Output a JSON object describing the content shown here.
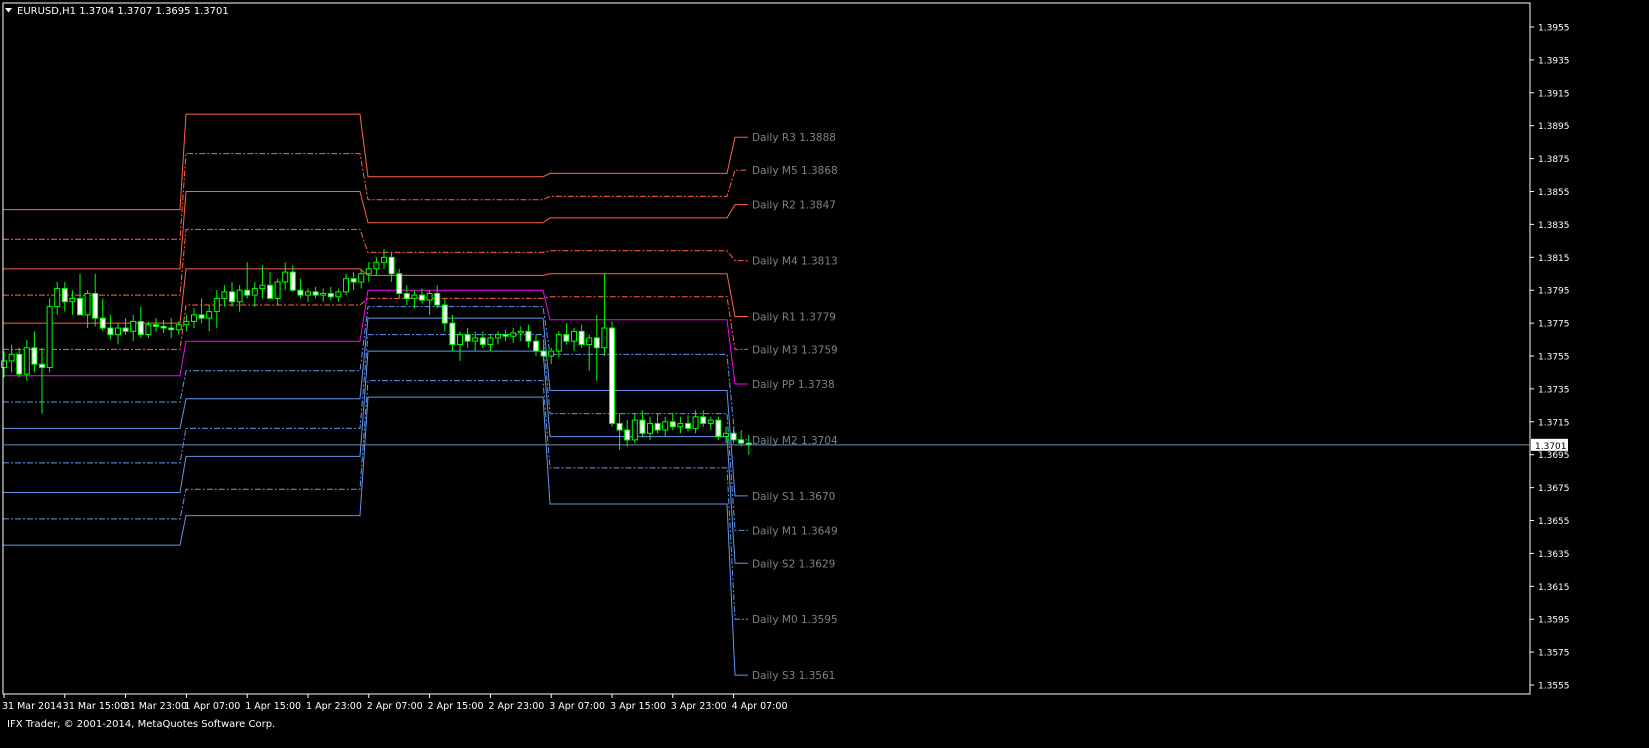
{
  "window": {
    "header_text": "EURUSD,H1  1.3704 1.3707 1.3695 1.3701",
    "menu_icon": "triangle-down-icon"
  },
  "footer": {
    "copyright": "IFX Trader, © 2001-2014, MetaQuotes Software Corp."
  },
  "colors": {
    "background": "#000000",
    "axis": "#ffffff",
    "bull": "#00ff00",
    "bear": "#ffffff",
    "resistance": "#ff6347",
    "pivot": "#ff00ff",
    "support": "#6495ed",
    "current_price_line": "#6e8fb0",
    "level_label": "#808080"
  },
  "chart_data": {
    "type": "candlestick",
    "symbol": "EURUSD",
    "timeframe": "H1",
    "ylim": [
      1.3545,
      1.3965
    ],
    "current_price": 1.3701,
    "current_price_label": "1.3701",
    "y_ticks": [
      "1.3955",
      "1.3935",
      "1.3915",
      "1.3895",
      "1.3875",
      "1.3855",
      "1.3835",
      "1.3815",
      "1.3795",
      "1.3775",
      "1.3755",
      "1.3735",
      "1.3715",
      "1.3695",
      "1.3675",
      "1.3655",
      "1.3635",
      "1.3615",
      "1.3595",
      "1.3575",
      "1.3555"
    ],
    "x_ticks": [
      "31 Mar 2014",
      "31 Mar 15:00",
      "31 Mar 23:00",
      "1 Apr 07:00",
      "1 Apr 15:00",
      "1 Apr 23:00",
      "2 Apr 07:00",
      "2 Apr 15:00",
      "2 Apr 23:00",
      "3 Apr 07:00",
      "3 Apr 15:00",
      "3 Apr 23:00",
      "4 Apr 07:00"
    ],
    "x_tick_index": [
      0,
      8,
      16,
      24,
      32,
      40,
      48,
      56,
      64,
      72,
      80,
      88,
      96
    ],
    "bar_count": 99,
    "ohlc": [
      [
        1.3748,
        1.3758,
        1.3742,
        1.3752
      ],
      [
        1.3752,
        1.3762,
        1.3745,
        1.3756
      ],
      [
        1.3756,
        1.376,
        1.3742,
        1.3744
      ],
      [
        1.3744,
        1.3765,
        1.374,
        1.376
      ],
      [
        1.376,
        1.377,
        1.3745,
        1.375
      ],
      [
        1.375,
        1.376,
        1.372,
        1.3748
      ],
      [
        1.3748,
        1.379,
        1.3745,
        1.3785
      ],
      [
        1.3785,
        1.38,
        1.378,
        1.3796
      ],
      [
        1.3796,
        1.38,
        1.3782,
        1.3788
      ],
      [
        1.3788,
        1.3795,
        1.378,
        1.379
      ],
      [
        1.379,
        1.3805,
        1.3782,
        1.378
      ],
      [
        1.378,
        1.3795,
        1.3772,
        1.3793
      ],
      [
        1.3793,
        1.3805,
        1.3773,
        1.3778
      ],
      [
        1.3778,
        1.379,
        1.377,
        1.3772
      ],
      [
        1.3772,
        1.378,
        1.3765,
        1.3768
      ],
      [
        1.3768,
        1.3775,
        1.3762,
        1.3772
      ],
      [
        1.3772,
        1.3778,
        1.3768,
        1.377
      ],
      [
        1.377,
        1.378,
        1.3764,
        1.3776
      ],
      [
        1.3776,
        1.3785,
        1.3766,
        1.3768
      ],
      [
        1.3768,
        1.3776,
        1.3766,
        1.3774
      ],
      [
        1.3774,
        1.3778,
        1.377,
        1.3773
      ],
      [
        1.3773,
        1.3777,
        1.3769,
        1.3772
      ],
      [
        1.3772,
        1.3778,
        1.3766,
        1.3771
      ],
      [
        1.3771,
        1.3776,
        1.3768,
        1.3774
      ],
      [
        1.3774,
        1.378,
        1.377,
        1.3776
      ],
      [
        1.3776,
        1.3784,
        1.3772,
        1.378
      ],
      [
        1.378,
        1.379,
        1.3775,
        1.3778
      ],
      [
        1.3778,
        1.3786,
        1.377,
        1.3782
      ],
      [
        1.3782,
        1.3795,
        1.3772,
        1.379
      ],
      [
        1.379,
        1.3798,
        1.3785,
        1.3794
      ],
      [
        1.3794,
        1.38,
        1.3785,
        1.3788
      ],
      [
        1.3788,
        1.3798,
        1.3782,
        1.3795
      ],
      [
        1.3795,
        1.3812,
        1.379,
        1.3792
      ],
      [
        1.3792,
        1.38,
        1.3785,
        1.3796
      ],
      [
        1.3796,
        1.381,
        1.379,
        1.3798
      ],
      [
        1.3798,
        1.3806,
        1.379,
        1.379
      ],
      [
        1.379,
        1.3802,
        1.3786,
        1.38
      ],
      [
        1.38,
        1.3812,
        1.3795,
        1.3806
      ],
      [
        1.3806,
        1.381,
        1.3794,
        1.3795
      ],
      [
        1.3795,
        1.3802,
        1.379,
        1.3792
      ],
      [
        1.3792,
        1.3796,
        1.3788,
        1.3794
      ],
      [
        1.3794,
        1.3797,
        1.379,
        1.3792
      ],
      [
        1.3792,
        1.3796,
        1.3788,
        1.3793
      ],
      [
        1.3793,
        1.3797,
        1.3789,
        1.3791
      ],
      [
        1.3791,
        1.3796,
        1.3788,
        1.3794
      ],
      [
        1.3794,
        1.3805,
        1.3792,
        1.3802
      ],
      [
        1.3802,
        1.3806,
        1.3795,
        1.38
      ],
      [
        1.38,
        1.3808,
        1.3796,
        1.3805
      ],
      [
        1.3805,
        1.3812,
        1.38,
        1.3808
      ],
      [
        1.3808,
        1.3815,
        1.3804,
        1.3812
      ],
      [
        1.3812,
        1.382,
        1.3808,
        1.3815
      ],
      [
        1.3815,
        1.3818,
        1.38,
        1.3805
      ],
      [
        1.3805,
        1.3808,
        1.379,
        1.3793
      ],
      [
        1.3793,
        1.3798,
        1.3786,
        1.379
      ],
      [
        1.379,
        1.3795,
        1.3784,
        1.3792
      ],
      [
        1.3792,
        1.3796,
        1.3787,
        1.3789
      ],
      [
        1.3789,
        1.3795,
        1.378,
        1.3793
      ],
      [
        1.3793,
        1.3798,
        1.3784,
        1.3786
      ],
      [
        1.3786,
        1.379,
        1.377,
        1.3775
      ],
      [
        1.3775,
        1.378,
        1.3758,
        1.3762
      ],
      [
        1.3762,
        1.377,
        1.3752,
        1.3768
      ],
      [
        1.3768,
        1.3772,
        1.376,
        1.3764
      ],
      [
        1.3764,
        1.377,
        1.3758,
        1.3766
      ],
      [
        1.3766,
        1.377,
        1.376,
        1.3762
      ],
      [
        1.3762,
        1.3768,
        1.3758,
        1.3766
      ],
      [
        1.3766,
        1.377,
        1.3762,
        1.3768
      ],
      [
        1.3768,
        1.3771,
        1.3764,
        1.3767
      ],
      [
        1.3767,
        1.3772,
        1.3763,
        1.3769
      ],
      [
        1.3769,
        1.3773,
        1.3764,
        1.377
      ],
      [
        1.377,
        1.3774,
        1.376,
        1.3764
      ],
      [
        1.3764,
        1.3768,
        1.3755,
        1.3758
      ],
      [
        1.3758,
        1.3762,
        1.3752,
        1.3755
      ],
      [
        1.3755,
        1.376,
        1.375,
        1.3758
      ],
      [
        1.3758,
        1.377,
        1.3754,
        1.3768
      ],
      [
        1.3768,
        1.3775,
        1.3762,
        1.3764
      ],
      [
        1.3764,
        1.3772,
        1.3758,
        1.377
      ],
      [
        1.377,
        1.3774,
        1.376,
        1.3762
      ],
      [
        1.3762,
        1.3768,
        1.3746,
        1.3766
      ],
      [
        1.3766,
        1.378,
        1.374,
        1.376
      ],
      [
        1.376,
        1.3805,
        1.3755,
        1.3772
      ],
      [
        1.3772,
        1.3776,
        1.3712,
        1.3714
      ],
      [
        1.3714,
        1.372,
        1.3698,
        1.371
      ],
      [
        1.371,
        1.3716,
        1.37,
        1.3704
      ],
      [
        1.3704,
        1.372,
        1.3702,
        1.3716
      ],
      [
        1.3716,
        1.3722,
        1.3706,
        1.3708
      ],
      [
        1.3708,
        1.3718,
        1.3704,
        1.3714
      ],
      [
        1.3714,
        1.372,
        1.3708,
        1.371
      ],
      [
        1.371,
        1.3718,
        1.3706,
        1.3715
      ],
      [
        1.3715,
        1.372,
        1.371,
        1.3712
      ],
      [
        1.3712,
        1.3718,
        1.3708,
        1.3714
      ],
      [
        1.3714,
        1.3719,
        1.3709,
        1.3711
      ],
      [
        1.3711,
        1.3722,
        1.3708,
        1.3718
      ],
      [
        1.3718,
        1.3722,
        1.3712,
        1.3714
      ],
      [
        1.3714,
        1.3718,
        1.371,
        1.3716
      ],
      [
        1.3716,
        1.3718,
        1.3704,
        1.3706
      ],
      [
        1.3706,
        1.3712,
        1.3702,
        1.3708
      ],
      [
        1.3708,
        1.3712,
        1.3702,
        1.3704
      ],
      [
        1.3704,
        1.371,
        1.37,
        1.3702
      ],
      [
        1.3702,
        1.3707,
        1.3695,
        1.3701
      ]
    ],
    "pivot_levels": [
      {
        "name": "R3",
        "label": "Daily R3 1.3888",
        "kind": "resistance",
        "style": "solid",
        "values": [
          1.3844,
          1.3902,
          1.3864,
          1.3866,
          1.3888
        ]
      },
      {
        "name": "M5",
        "label": "Daily M5 1.3868",
        "kind": "resistance",
        "style": "dashdot",
        "values": [
          1.3826,
          1.3878,
          1.385,
          1.3852,
          1.3868
        ]
      },
      {
        "name": "R2",
        "label": "Daily R2 1.3847",
        "kind": "resistance",
        "style": "solid",
        "values": [
          1.3808,
          1.3855,
          1.3836,
          1.3839,
          1.3847
        ]
      },
      {
        "name": "M4",
        "label": "Daily M4 1.3813",
        "kind": "resistance",
        "style": "dashdot",
        "values": [
          1.3792,
          1.3832,
          1.3818,
          1.3819,
          1.3813
        ]
      },
      {
        "name": "R1",
        "label": "Daily R1 1.3779",
        "kind": "resistance",
        "style": "solid",
        "values": [
          1.3775,
          1.3808,
          1.3804,
          1.3805,
          1.3779
        ]
      },
      {
        "name": "M3",
        "label": "Daily M3 1.3759",
        "kind": "resistance",
        "style": "dashdot",
        "values": [
          1.3759,
          1.3786,
          1.379,
          1.3791,
          1.3759
        ]
      },
      {
        "name": "PP",
        "label": "Daily PP 1.3738",
        "kind": "pivot",
        "style": "solid",
        "values": [
          1.3743,
          1.3764,
          1.3795,
          1.3777,
          1.3738
        ]
      },
      {
        "name": "M2",
        "label": "Daily M2 1.3704",
        "kind": "support",
        "style": "dashdot",
        "values": [
          1.3727,
          1.3746,
          1.3785,
          1.3756,
          1.3704
        ]
      },
      {
        "name": "S1",
        "label": "Daily S1 1.3670",
        "kind": "support",
        "style": "solid",
        "values": [
          1.3711,
          1.3729,
          1.3778,
          1.3734,
          1.367
        ]
      },
      {
        "name": "M1",
        "label": "Daily M1 1.3649",
        "kind": "support",
        "style": "dashdot",
        "values": [
          1.369,
          1.3711,
          1.3768,
          1.372,
          1.3649
        ]
      },
      {
        "name": "S2",
        "label": "Daily S2 1.3629",
        "kind": "support",
        "style": "solid",
        "values": [
          1.3672,
          1.3694,
          1.3758,
          1.3706,
          1.3629
        ]
      },
      {
        "name": "M0",
        "label": "Daily M0 1.3595",
        "kind": "support",
        "style": "dashdot",
        "values": [
          1.3656,
          1.3674,
          1.374,
          1.3687,
          1.3595
        ]
      },
      {
        "name": "S3",
        "label": "Daily S3 1.3561",
        "kind": "support",
        "style": "solid",
        "values": [
          1.364,
          1.3658,
          1.373,
          1.3665,
          1.3561
        ]
      }
    ]
  }
}
